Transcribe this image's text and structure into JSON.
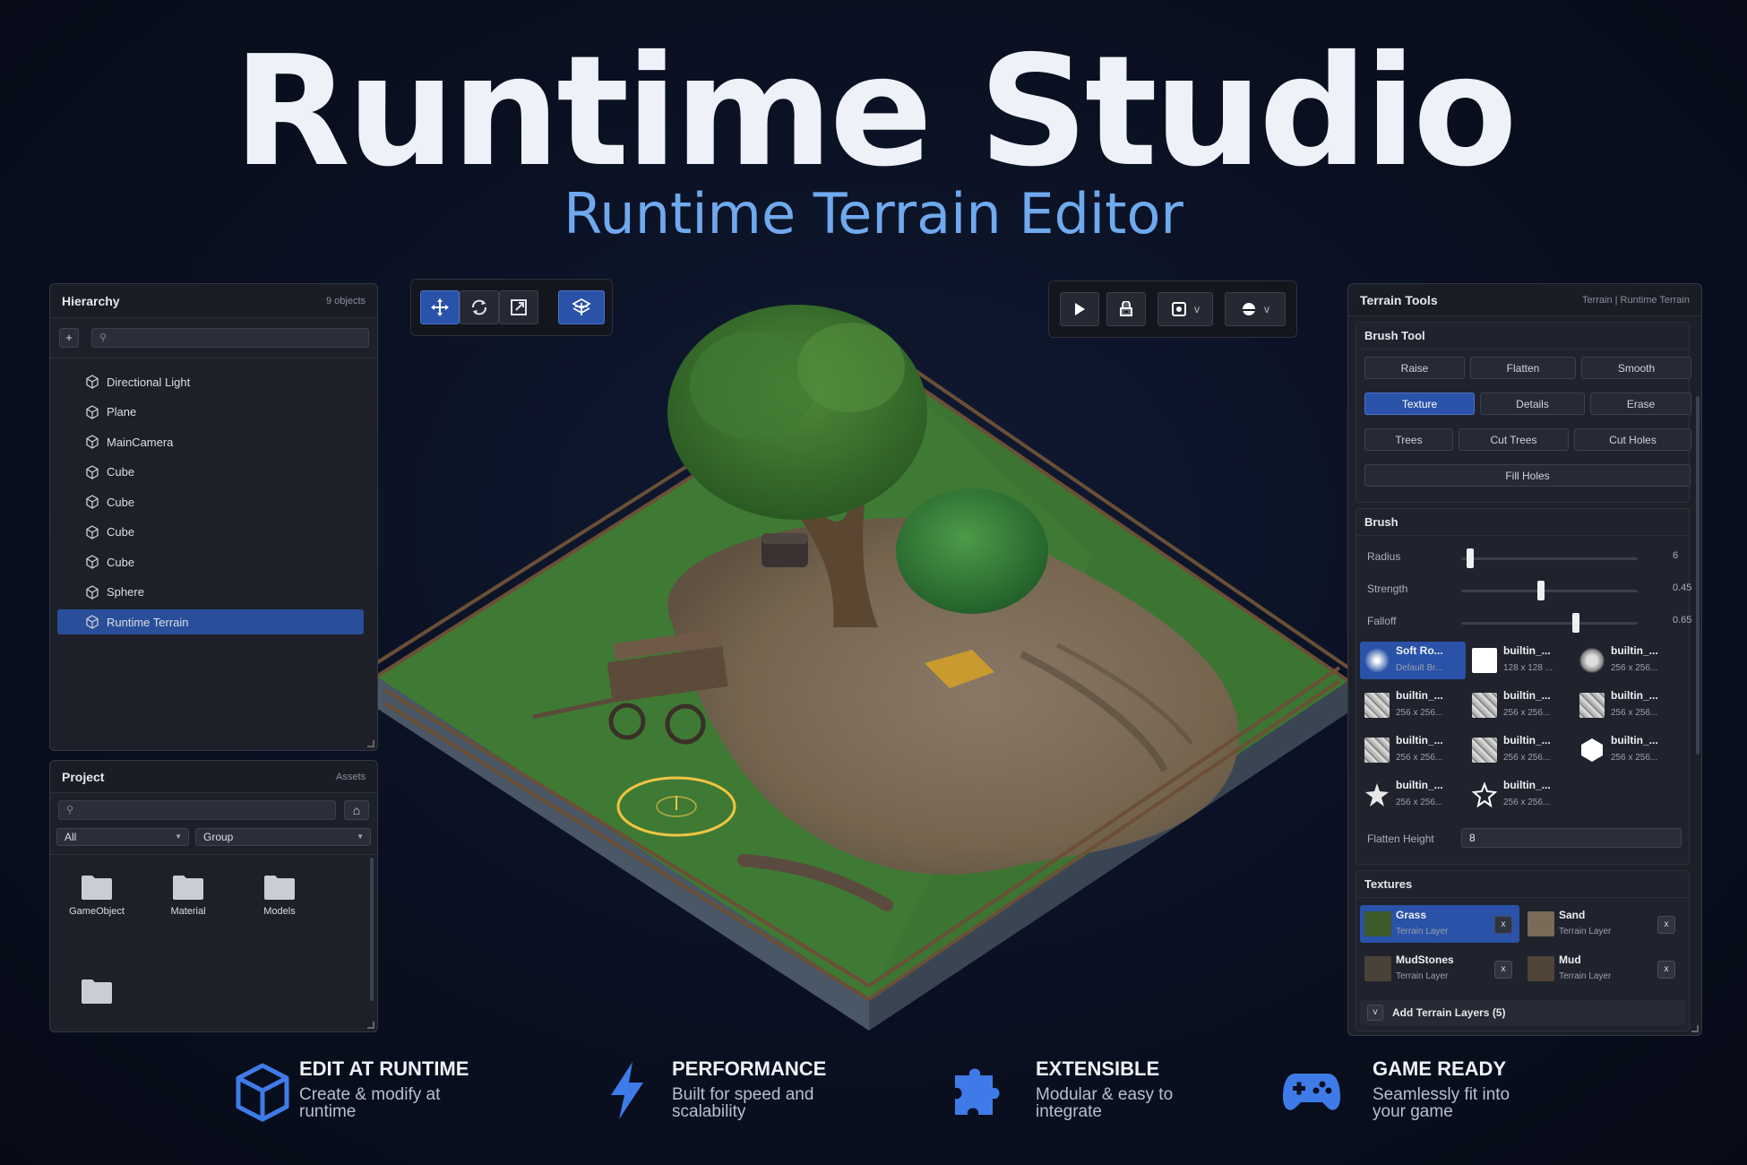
{
  "hero": {
    "title": "Runtime Studio",
    "subtitle": "Runtime Terrain Editor"
  },
  "hierarchy": {
    "title": "Hierarchy",
    "count": "9 objects",
    "add_label": "+",
    "search_placeholder": "",
    "items": [
      {
        "label": "Directional Light"
      },
      {
        "label": "Plane"
      },
      {
        "label": "MainCamera"
      },
      {
        "label": "Cube"
      },
      {
        "label": "Cube"
      },
      {
        "label": "Cube"
      },
      {
        "label": "Cube"
      },
      {
        "label": "Sphere"
      },
      {
        "label": "Runtime Terrain",
        "selected": true
      }
    ]
  },
  "project": {
    "title": "Project",
    "subtitle": "Assets",
    "filter_value": "All",
    "group_value": "Group",
    "folders": [
      {
        "label": "GameObject"
      },
      {
        "label": "Material"
      },
      {
        "label": "Models"
      },
      {
        "label": ""
      }
    ]
  },
  "toolbar_left": {
    "tools": [
      "move-icon",
      "rotate-icon",
      "scale-icon",
      "pivot-icon"
    ],
    "active": [
      "move",
      "pivot"
    ]
  },
  "toolbar_right": {
    "dropdown_marker": "v"
  },
  "terrain": {
    "title": "Terrain Tools",
    "breadcrumb": "Terrain | Runtime Terrain",
    "brush_tool": {
      "title": "Brush Tool",
      "buttons": [
        "Raise",
        "Flatten",
        "Smooth",
        "Texture",
        "Details",
        "Erase",
        "Trees",
        "Cut Trees",
        "Cut Holes",
        "Fill Holes"
      ],
      "active": "Texture"
    },
    "brush": {
      "title": "Brush",
      "radius_label": "Radius",
      "radius_value": "6",
      "radius_fraction": 0.05,
      "strength_label": "Strength",
      "strength_value": "0.45",
      "strength_fraction": 0.45,
      "falloff_label": "Falloff",
      "falloff_value": "0.65",
      "falloff_fraction": 0.65,
      "brushes": [
        {
          "name": "Soft Ro...",
          "desc": "Default Br...",
          "selected": true
        },
        {
          "name": "builtin_...",
          "desc": "128 x 128 ..."
        },
        {
          "name": "builtin_...",
          "desc": "256 x 256..."
        },
        {
          "name": "builtin_...",
          "desc": "256 x 256..."
        },
        {
          "name": "builtin_...",
          "desc": "256 x 256..."
        },
        {
          "name": "builtin_...",
          "desc": "256 x 256..."
        },
        {
          "name": "builtin_...",
          "desc": "256 x 256..."
        },
        {
          "name": "builtin_...",
          "desc": "256 x 256..."
        },
        {
          "name": "builtin_...",
          "desc": "256 x 256..."
        },
        {
          "name": "builtin_...",
          "desc": "256 x 256..."
        },
        {
          "name": "builtin_...",
          "desc": "256 x 256..."
        }
      ],
      "flatten_label": "Flatten Height",
      "flatten_value": "8"
    },
    "textures": {
      "title": "Textures",
      "items": [
        {
          "name": "Grass",
          "desc": "Terrain Layer",
          "color": "#3d5a2a",
          "selected": true
        },
        {
          "name": "Sand",
          "desc": "Terrain Layer",
          "color": "#7a6a58"
        },
        {
          "name": "MudStones",
          "desc": "Terrain Layer",
          "color": "#4a4238"
        },
        {
          "name": "Mud",
          "desc": "Terrain Layer",
          "color": "#4f4437"
        }
      ],
      "remove_label": "x",
      "expand_label": "v",
      "add_label": "Add Terrain Layers (5)"
    }
  },
  "features": [
    {
      "title": "EDIT AT RUNTIME",
      "desc": "Create & modify at runtime",
      "icon": "cube-icon"
    },
    {
      "title": "PERFORMANCE",
      "desc": "Built for speed and scalability",
      "icon": "lightning-icon"
    },
    {
      "title": "EXTENSIBLE",
      "desc": "Modular & easy to integrate",
      "icon": "puzzle-icon"
    },
    {
      "title": "GAME READY",
      "desc": "Seamlessly fit into your game",
      "icon": "gamepad-icon"
    }
  ],
  "colors": {
    "accent": "#2952a8",
    "title_sub": "#6fa9ee",
    "grass": "#3f7a34",
    "dirt": "#7d6b58"
  }
}
